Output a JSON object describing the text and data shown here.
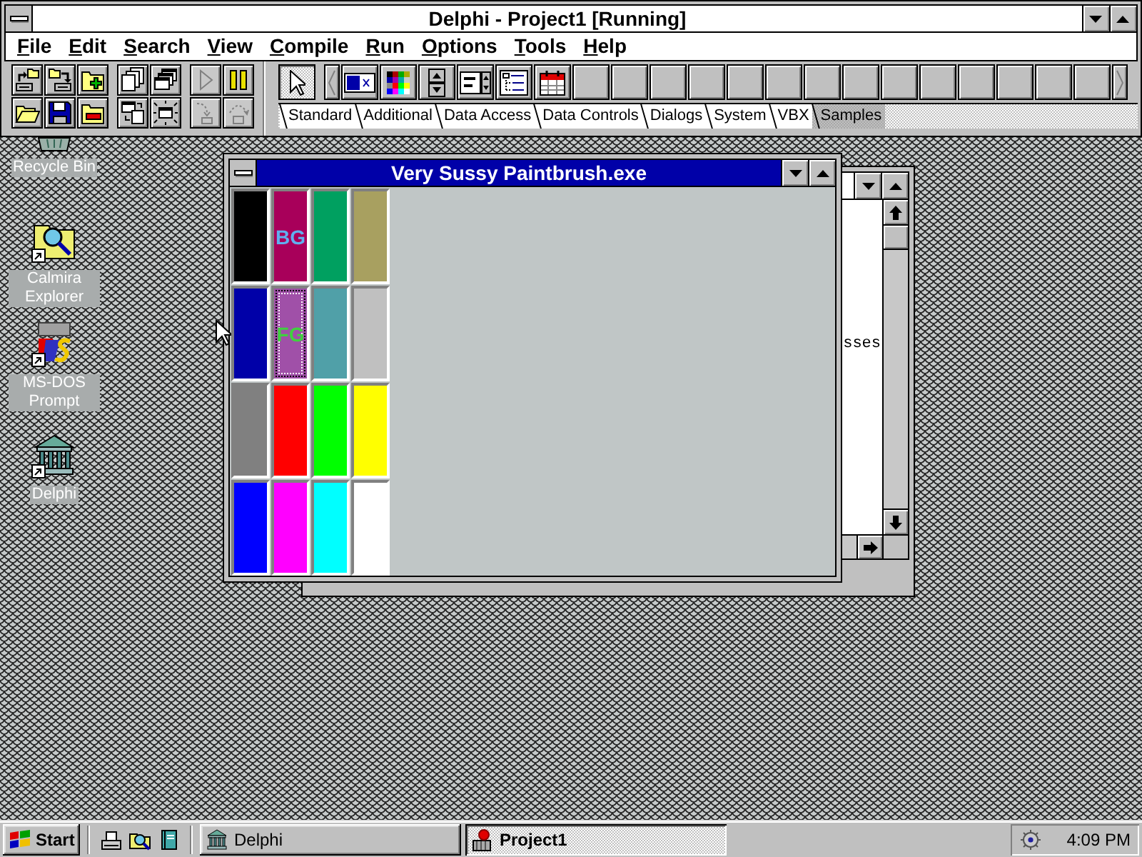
{
  "main_window": {
    "title": "Delphi - Project1 [Running]",
    "menu": [
      "File",
      "Edit",
      "Search",
      "View",
      "Compile",
      "Run",
      "Options",
      "Tools",
      "Help"
    ]
  },
  "speedbar": [
    {
      "buttons": [
        {
          "disabled": false
        },
        {
          "disabled": false
        },
        {
          "disabled": false
        },
        {
          "disabled": false
        },
        {
          "disabled": false
        },
        {
          "disabled": false
        }
      ]
    },
    {
      "buttons": [
        {
          "disabled": false
        },
        {
          "disabled": false
        },
        {
          "disabled": false
        },
        {
          "disabled": false
        }
      ]
    },
    {
      "buttons": [
        {
          "disabled": true
        },
        {
          "disabled": false
        },
        {
          "disabled": true
        },
        {
          "disabled": true
        }
      ]
    }
  ],
  "component_palette": {
    "pointer": {
      "selected": true
    },
    "tabs": [
      {
        "label": "Standard",
        "selected": false
      },
      {
        "label": "Additional",
        "selected": false
      },
      {
        "label": "Data Access",
        "selected": false
      },
      {
        "label": "Data Controls",
        "selected": false
      },
      {
        "label": "Dialogs",
        "selected": false
      },
      {
        "label": "System",
        "selected": false
      },
      {
        "label": "VBX",
        "selected": false
      },
      {
        "label": "Samples",
        "selected": true
      }
    ]
  },
  "desktop_icons": [
    {
      "label": "Recycle Bin"
    },
    {
      "label": "Calmira Explorer"
    },
    {
      "label": "MS-DOS Prompt"
    },
    {
      "label": "Delphi"
    }
  ],
  "editor_window": {
    "text": "sses"
  },
  "paint_window": {
    "title": "Very Sussy Paintbrush.exe",
    "palette": [
      {
        "color": "#000000",
        "kind": "plain",
        "selected": false
      },
      {
        "color": "#a8005a",
        "kind": "background",
        "label": "BG",
        "selected": false
      },
      {
        "color": "#00a060",
        "kind": "plain",
        "selected": false
      },
      {
        "color": "#a8a060",
        "kind": "plain",
        "selected": false
      },
      {
        "color": "#0000a8",
        "kind": "plain",
        "selected": false
      },
      {
        "color": "#a050a8",
        "kind": "foreground",
        "label": "FG",
        "selected": true
      },
      {
        "color": "#50a0a8",
        "kind": "plain",
        "selected": false
      },
      {
        "color": "#c0c0c0",
        "kind": "plain",
        "selected": false
      },
      {
        "color": "#808080",
        "kind": "plain",
        "selected": false
      },
      {
        "color": "#ff0000",
        "kind": "plain",
        "selected": false
      },
      {
        "color": "#00ff00",
        "kind": "plain",
        "selected": false
      },
      {
        "color": "#ffff00",
        "kind": "plain",
        "selected": false
      },
      {
        "color": "#0000ff",
        "kind": "plain",
        "selected": false
      },
      {
        "color": "#ff00ff",
        "kind": "plain",
        "selected": false
      },
      {
        "color": "#00ffff",
        "kind": "plain",
        "selected": false
      },
      {
        "color": "#ffffff",
        "kind": "plain",
        "selected": false
      }
    ]
  },
  "taskbar": {
    "start": "Start",
    "tasks": [
      {
        "label": "Delphi",
        "selected": false
      },
      {
        "label": "Project1",
        "selected": true
      }
    ],
    "clock": "4:09 PM"
  }
}
